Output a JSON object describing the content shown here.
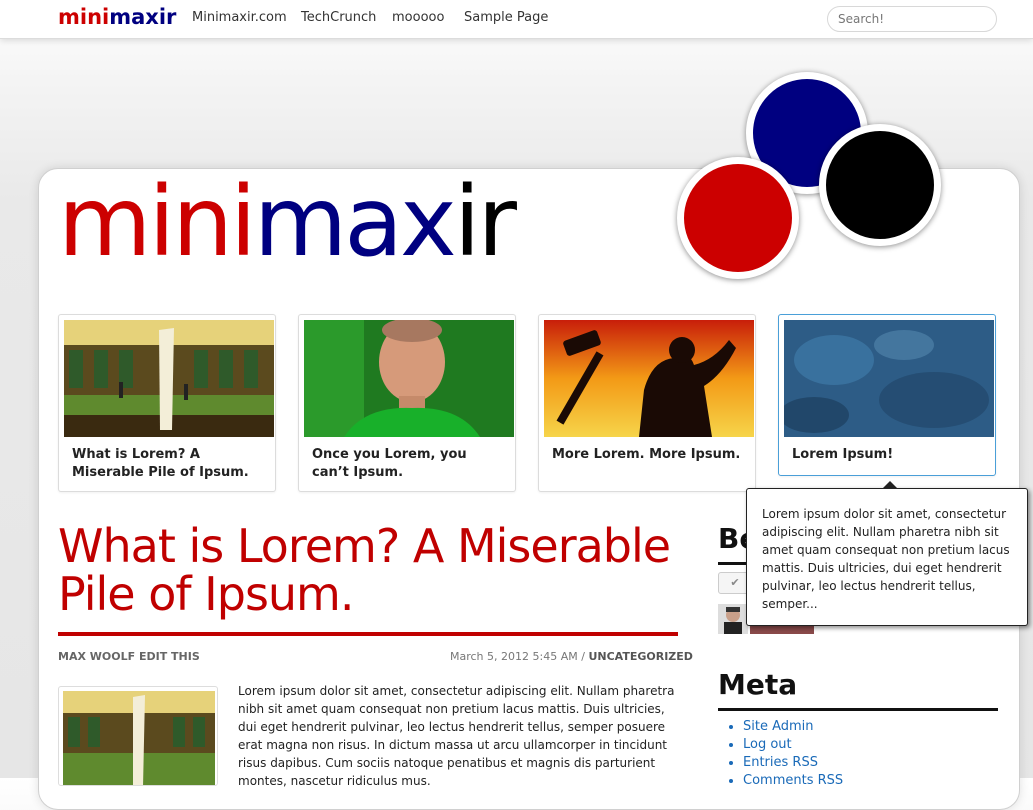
{
  "top_nav": {
    "logo_mini": "mini",
    "logo_maxir": "maxir",
    "links": [
      "Minimaxir.com",
      "TechCrunch",
      "mooooo",
      "Sample Page"
    ],
    "search_placeholder": "Search!"
  },
  "header": {
    "logo_mini": "mini",
    "logo_maxir": "maxir",
    "circle_colors": [
      "#000080",
      "#000000",
      "#cc0000"
    ]
  },
  "featured": [
    {
      "title": "What is Lorem? A Miserable Pile of Ipsum.",
      "image": "building-photo"
    },
    {
      "title": "Once you Lorem, you can’t Ipsum.",
      "image": "man-green-shirt-photo"
    },
    {
      "title": "More Lorem. More Ipsum.",
      "image": "silhouette-hammer-photo"
    },
    {
      "title": "Lorem Ipsum!",
      "image": "blue-texture-photo"
    }
  ],
  "tooltip": {
    "text": "Lorem ipsum dolor sit amet, consectetur adipiscing elit. Nullam pharetra nibh sit amet quam consequat non pretium lacus mattis. Duis ultricies, dui eget hendrerit pulvinar, leo lectus hendrerit tellus, semper..."
  },
  "post": {
    "title": "What is Lorem? A Miserable Pile of Ipsum.",
    "author": "MAX WOOLF",
    "edit_label": "EDIT THIS",
    "date": "March 5, 2012 5:45 AM",
    "separator": "/",
    "category": "UNCATEGORIZED",
    "body": "Lorem ipsum dolor sit amet, consectetur adipiscing elit. Nullam pharetra nibh sit amet quam consequat non pretium lacus mattis. Duis ultricies, dui eget hendrerit pulvinar, leo lectus hendrerit tellus, semper posuere erat magna non risus. In dictum massa ut arcu ullamcorper in tincidunt risus dapibus. Cum sociis natoque penatibus et magnis dis parturient montes, nascetur ridiculus mus."
  },
  "sidebar": {
    "partial_heading": "Be",
    "meta_heading": "Meta",
    "meta_links": [
      "Site Admin",
      "Log out",
      "Entries RSS",
      "Comments RSS"
    ]
  },
  "colors": {
    "brand_red": "#cc0000",
    "brand_navy": "#000080",
    "link_blue": "#1a6ab8",
    "active_border": "#4a9fd8"
  }
}
